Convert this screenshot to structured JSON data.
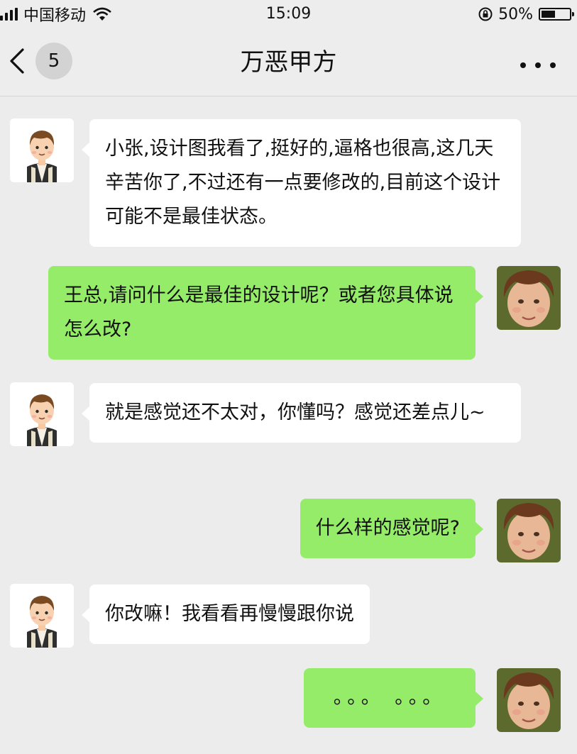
{
  "status_bar": {
    "carrier": "中国移动",
    "time": "15:09",
    "battery_text": "50%",
    "battery_level": 0.5
  },
  "nav": {
    "back_badge": "5",
    "title": "万恶甲方",
    "more_icon": "more-dots-icon"
  },
  "colors": {
    "background": "#ececec",
    "incoming_bubble": "#ffffff",
    "outgoing_bubble": "#95ec69"
  },
  "messages": [
    {
      "direction": "in",
      "sender_avatar": "cartoon-boy-avatar",
      "text": "小张,设计图我看了,挺好的,逼格也很高,这几天辛苦你了,不过还有一点要修改的,目前这个设计可能不是最佳状态。"
    },
    {
      "direction": "out",
      "sender_avatar": "photo-boy-avatar",
      "text": "王总,请问什么是最佳的设计呢？或者您具体说怎么改?"
    },
    {
      "direction": "in",
      "sender_avatar": "cartoon-boy-avatar",
      "text": "就是感觉还不太对，你懂吗？感觉还差点儿~"
    },
    {
      "direction": "out",
      "sender_avatar": "photo-boy-avatar",
      "text": "什么样的感觉呢?"
    },
    {
      "direction": "in",
      "sender_avatar": "cartoon-boy-avatar",
      "text": "你改嘛！我看看再慢慢跟你说"
    },
    {
      "direction": "out",
      "sender_avatar": "photo-boy-avatar",
      "text": "。。。 。。。"
    }
  ]
}
